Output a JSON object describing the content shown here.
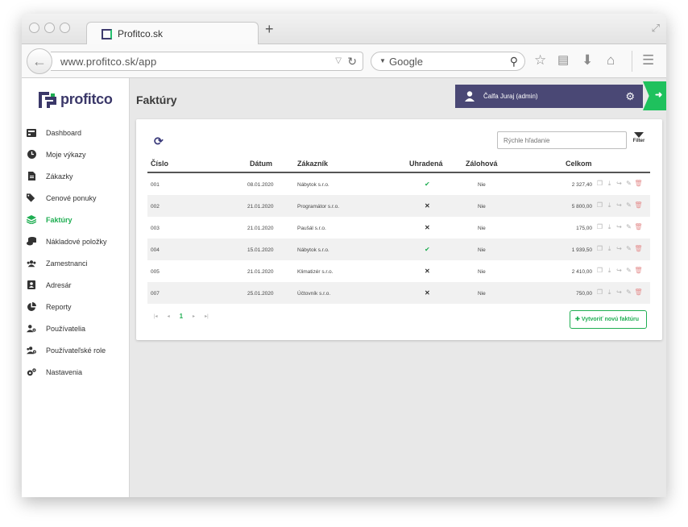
{
  "browser": {
    "tab_title": "Profitco.sk",
    "new_tab": "+",
    "url": "www.profitco.sk/app",
    "search_placeholder": "Google"
  },
  "brand": {
    "name": "profitco",
    "color_primary": "#3b3869",
    "color_accent": "#1fae52"
  },
  "sidebar": {
    "items": [
      {
        "label": "Dashboard",
        "icon": "dashboard-icon",
        "active": false
      },
      {
        "label": "Moje výkazy",
        "icon": "clock-icon",
        "active": false
      },
      {
        "label": "Zákazky",
        "icon": "file-icon",
        "active": false
      },
      {
        "label": "Cenové ponuky",
        "icon": "tags-icon",
        "active": false
      },
      {
        "label": "Faktúry",
        "icon": "layers-icon",
        "active": true
      },
      {
        "label": "Nákladové položky",
        "icon": "coins-icon",
        "active": false
      },
      {
        "label": "Zamestnanci",
        "icon": "users-icon",
        "active": false
      },
      {
        "label": "Adresár",
        "icon": "address-book-icon",
        "active": false
      },
      {
        "label": "Reporty",
        "icon": "pie-chart-icon",
        "active": false
      },
      {
        "label": "Používatelia",
        "icon": "user-gear-icon",
        "active": false
      },
      {
        "label": "Používateľské role",
        "icon": "users-gear-icon",
        "active": false
      },
      {
        "label": "Nastavenia",
        "icon": "gears-icon",
        "active": false
      }
    ]
  },
  "header": {
    "page_title": "Faktúry",
    "user": "Čalfa Juraj (admin)"
  },
  "toolbar": {
    "search_placeholder": "Rýchle hľadanie",
    "filter_label": "Filter"
  },
  "table": {
    "columns": [
      "Číslo",
      "Dátum",
      "Zákazník",
      "Uhradená",
      "Zálohová",
      "Celkom"
    ],
    "rows": [
      {
        "number": "001",
        "date": "08.01.2020",
        "customer": "Nábytok s.r.o.",
        "paid": true,
        "advance": "Nie",
        "total": "2 327,40"
      },
      {
        "number": "002",
        "date": "21.01.2020",
        "customer": "Programátor s.r.o.",
        "paid": false,
        "advance": "Nie",
        "total": "5 800,00"
      },
      {
        "number": "003",
        "date": "21.01.2020",
        "customer": "Paušál s.r.o.",
        "paid": false,
        "advance": "Nie",
        "total": "175,00"
      },
      {
        "number": "004",
        "date": "15.01.2020",
        "customer": "Nábytok s.r.o.",
        "paid": true,
        "advance": "Nie",
        "total": "1 939,50"
      },
      {
        "number": "005",
        "date": "21.01.2020",
        "customer": "Klimatizér s.r.o.",
        "paid": false,
        "advance": "Nie",
        "total": "2 410,00"
      },
      {
        "number": "007",
        "date": "25.01.2020",
        "customer": "Účtovník s.r.o.",
        "paid": false,
        "advance": "Nie",
        "total": "750,00"
      }
    ]
  },
  "pagination": {
    "current": "1"
  },
  "create_button": "Vytvoriť novú faktúru"
}
